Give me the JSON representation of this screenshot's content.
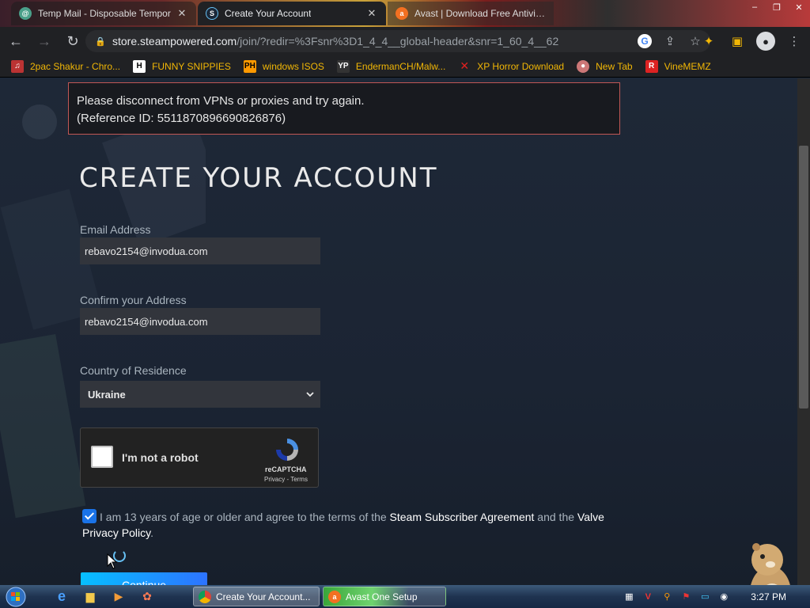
{
  "browser": {
    "tabs": [
      {
        "label": "Temp Mail - Disposable Tempor",
        "icon": "tempmail-favicon",
        "close": "✕"
      },
      {
        "label": "Create Your Account",
        "icon": "steam-favicon",
        "close": "✕"
      },
      {
        "label": "Avast | Download Free Antivirus",
        "icon": "avast-favicon"
      }
    ],
    "url_host": "store.steampowered.com",
    "url_path": "/join/?redir=%3Fsnr%3D1_4_4__global-header&snr=1_60_4__62",
    "bookmarks": [
      {
        "label": "2pac Shakur - Chro...",
        "icon": "music-icon",
        "color": "#f2b705"
      },
      {
        "label": "FUNNY SNIPPIES",
        "icon": "h-icon",
        "color": "#f2b705"
      },
      {
        "label": "windows ISOS",
        "icon": "ph-icon",
        "color": "#f2b705"
      },
      {
        "label": "EndermanCH/Malw...",
        "icon": "yt-icon",
        "color": "#f2b705"
      },
      {
        "label": "XP Horror Download",
        "icon": "x-icon",
        "color": "#f2b705"
      },
      {
        "label": "New Tab",
        "icon": "newtab-icon",
        "color": "#f2b705"
      },
      {
        "label": "VineMEMZ",
        "icon": "r-icon",
        "color": "#f2b705"
      }
    ]
  },
  "page": {
    "error": {
      "line1": "Please disconnect from VPNs or proxies and try again.",
      "line2": "(Reference ID: 5511870896690826876)"
    },
    "title": "CREATE YOUR ACCOUNT",
    "email": {
      "label": "Email Address",
      "value": "rebavo2154@invodua.com"
    },
    "confirm": {
      "label": "Confirm your Address",
      "value": "rebavo2154@invodua.com"
    },
    "country": {
      "label": "Country of Residence",
      "value": "Ukraine"
    },
    "captcha": {
      "label": "I'm not a robot",
      "brand": "reCAPTCHA",
      "links": "Privacy - Terms"
    },
    "agree": {
      "text1": "I am 13 years of age or older and agree to the terms of the ",
      "link1": "Steam Subscriber Agreement",
      "text2": " and the ",
      "link2": "Valve Privacy Policy",
      "text3": "."
    },
    "continue_label": "Continue"
  },
  "taskbar": {
    "tasks": [
      {
        "label": "Create Your Account...",
        "icon": "chrome-icon"
      },
      {
        "label": "Avast One Setup",
        "icon": "avast-icon"
      }
    ],
    "clock": "3:27 PM"
  },
  "colors": {
    "accent": "#66c0f4",
    "error_border": "#c15755",
    "bookmark_text": "#f2b705"
  }
}
